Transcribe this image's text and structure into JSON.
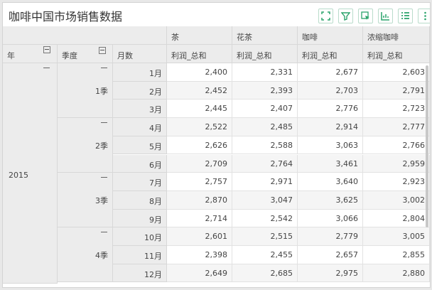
{
  "title": "咖啡中国市场销售数据",
  "toolbar": [
    {
      "name": "fullscreen-icon",
      "label": "fullscreen"
    },
    {
      "name": "filter-icon",
      "label": "filter"
    },
    {
      "name": "select-icon",
      "label": "select"
    },
    {
      "name": "chart-icon",
      "label": "chart"
    },
    {
      "name": "list-icon",
      "label": "list"
    },
    {
      "name": "more-icon",
      "label": "more"
    }
  ],
  "headers": {
    "year": "年",
    "quarter": "季度",
    "month": "月数",
    "products": [
      "茶",
      "花茶",
      "咖啡",
      "浓缩咖啡"
    ],
    "measure": "利润_总和"
  },
  "year": "2015",
  "quarters": [
    "1季",
    "2季",
    "3季",
    "4季"
  ],
  "rows": [
    {
      "month": "1月",
      "values": [
        "2,400",
        "2,331",
        "2,677",
        "2,603"
      ]
    },
    {
      "month": "2月",
      "values": [
        "2,452",
        "2,393",
        "2,703",
        "2,791"
      ]
    },
    {
      "month": "3月",
      "values": [
        "2,445",
        "2,407",
        "2,776",
        "2,723"
      ]
    },
    {
      "month": "4月",
      "values": [
        "2,522",
        "2,485",
        "2,914",
        "2,777"
      ]
    },
    {
      "month": "5月",
      "values": [
        "2,626",
        "2,588",
        "3,063",
        "2,766"
      ]
    },
    {
      "month": "6月",
      "values": [
        "2,709",
        "2,764",
        "3,461",
        "2,959"
      ]
    },
    {
      "month": "7月",
      "values": [
        "2,757",
        "2,971",
        "3,640",
        "2,923"
      ]
    },
    {
      "month": "8月",
      "values": [
        "2,870",
        "3,047",
        "3,625",
        "3,002"
      ]
    },
    {
      "month": "9月",
      "values": [
        "2,714",
        "2,542",
        "3,066",
        "2,804"
      ]
    },
    {
      "month": "10月",
      "values": [
        "2,601",
        "2,515",
        "2,779",
        "3,005"
      ]
    },
    {
      "month": "11月",
      "values": [
        "2,398",
        "2,455",
        "2,657",
        "2,855"
      ]
    },
    {
      "month": "12月",
      "values": [
        "2,649",
        "2,685",
        "2,975",
        "2,880"
      ]
    }
  ]
}
